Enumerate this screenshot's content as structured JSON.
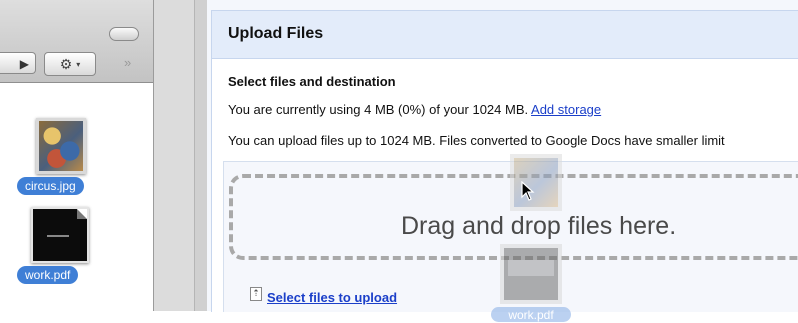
{
  "finder": {
    "toolbar": {
      "back_glyph": "▶",
      "gear_glyph": "⚙",
      "caret_glyph": "▾",
      "more_glyph": "»"
    },
    "files": [
      {
        "name": "circus.jpg",
        "icon": "image-thumbnail-icon"
      },
      {
        "name": "work.pdf",
        "icon": "pdf-thumbnail-icon"
      }
    ],
    "selection_color": "#3f7fd6"
  },
  "upload": {
    "title": "Upload Files",
    "section_title": "Select files and destination",
    "usage_text": "You are currently using 4 MB (0%) of your 1024 MB.",
    "add_storage_link": "Add storage",
    "limit_text": "You can upload files up to 1024 MB. Files converted to Google Docs have smaller limit",
    "drop_text": "Drag and drop files here.",
    "select_link": "Select files to upload",
    "upload_icon_glyph": "⇡",
    "drag_ghost_label": "work.pdf",
    "link_color": "#1b3fc9",
    "header_bg": "#e3ecfa"
  }
}
